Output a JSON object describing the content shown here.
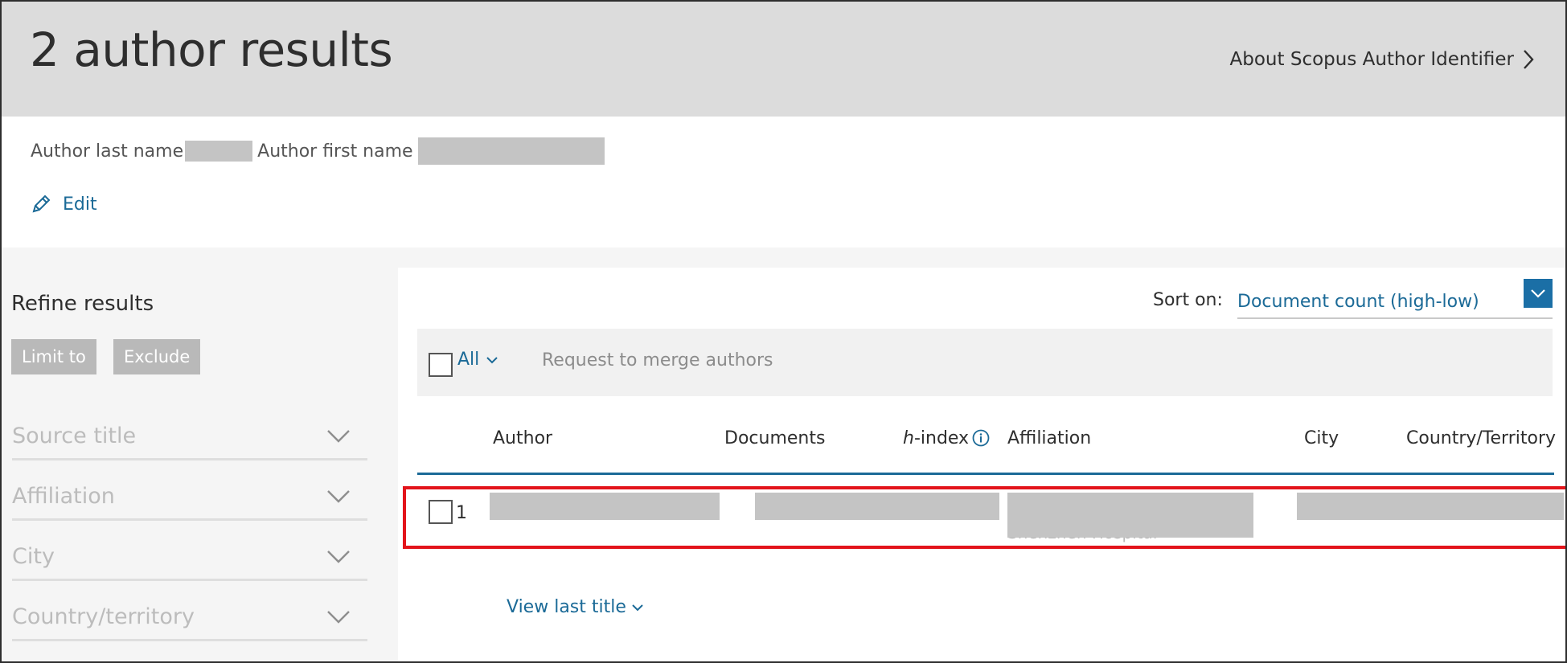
{
  "header": {
    "title": "2 author results",
    "about_link": "About Scopus Author Identifier"
  },
  "query": {
    "last_name_label": "Author last name",
    "first_name_label": "Author first name",
    "edit_label": "Edit"
  },
  "sidebar": {
    "title": "Refine results",
    "limit_to": "Limit to",
    "exclude": "Exclude",
    "facets": [
      {
        "label": "Source title"
      },
      {
        "label": "Affiliation"
      },
      {
        "label": "City"
      },
      {
        "label": "Country/territory"
      }
    ]
  },
  "results": {
    "sort_label": "Sort on:",
    "sort_value": "Document count (high-low)",
    "select_all": "All",
    "merge_label": "Request to merge authors",
    "columns": {
      "author": "Author",
      "documents": "Documents",
      "hindex_prefix": "h",
      "hindex_suffix": "-index",
      "affiliation": "Affiliation",
      "city": "City",
      "country": "Country/Territory"
    },
    "rows": [
      {
        "index": "1",
        "affiliation_partial": "Shenzhen Hospital"
      }
    ],
    "view_last_title": "View last title"
  },
  "colors": {
    "link": "#1b6a97",
    "accent_button": "#1b6fa6",
    "highlight_border": "#e3141b",
    "header_bg": "#dcdcdc"
  }
}
